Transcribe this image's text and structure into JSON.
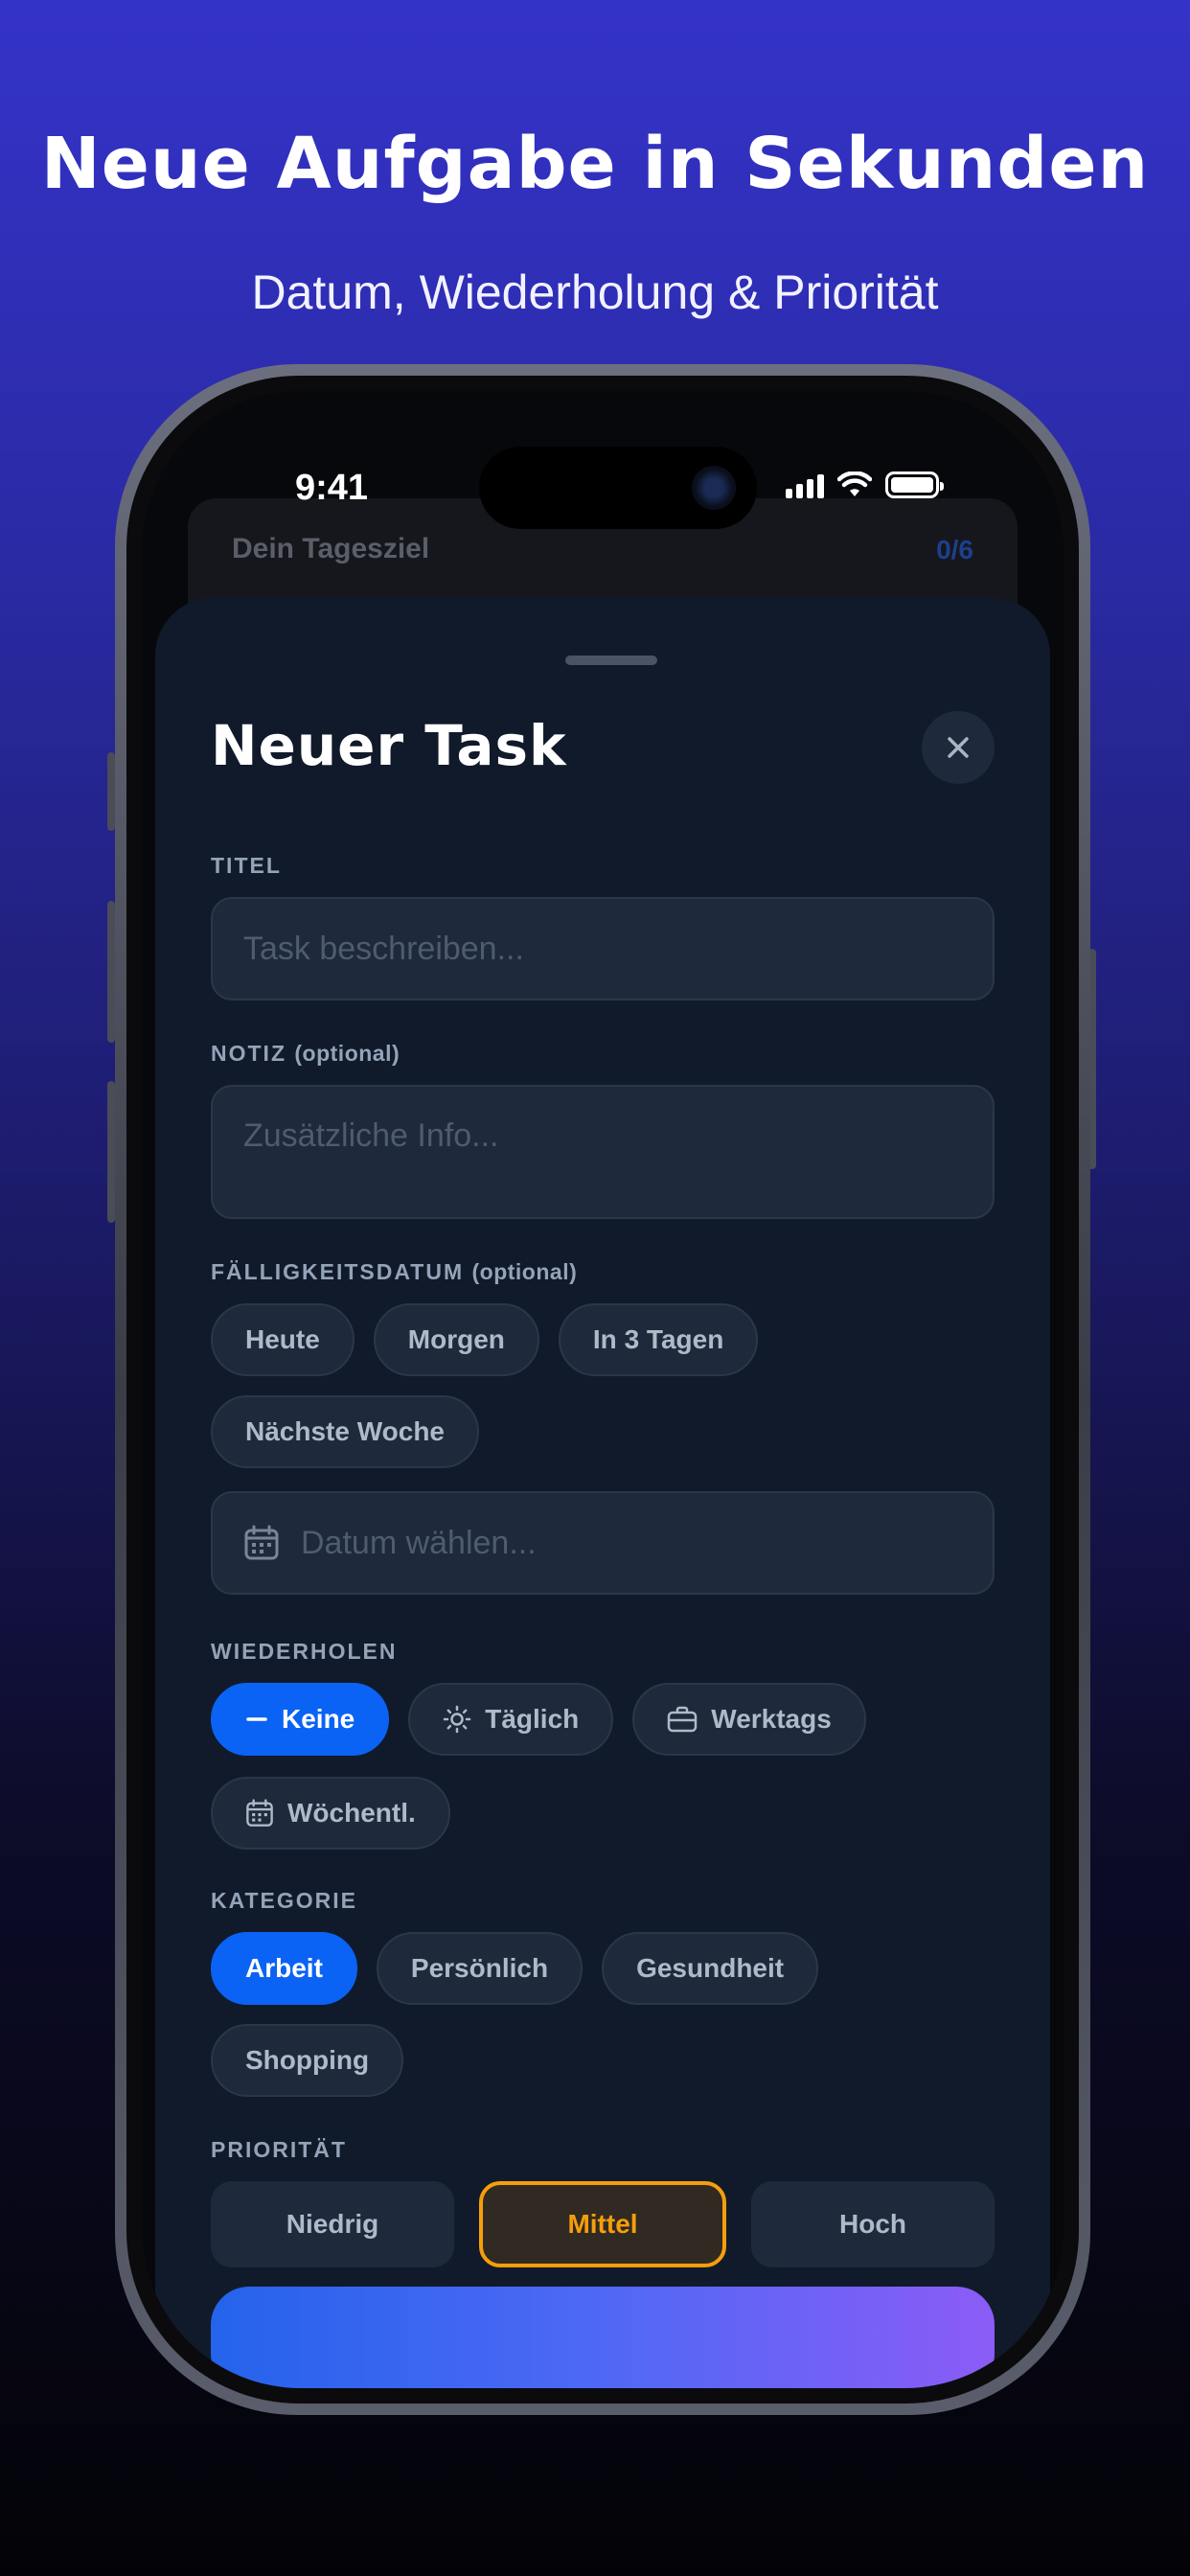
{
  "promo": {
    "headline": "Neue Aufgabe in Sekunden",
    "subline": "Datum, Wiederholung & Priorität"
  },
  "status_bar": {
    "time": "9:41"
  },
  "background_card": {
    "title": "Dein Tagesziel",
    "count": "0/6"
  },
  "sheet": {
    "title": "Neuer Task",
    "close_icon": "close-icon",
    "title_field": {
      "label": "TITEL",
      "placeholder": "Task beschreiben..."
    },
    "note_field": {
      "label": "NOTIZ",
      "label_suffix": "(optional)",
      "placeholder": "Zusätzliche Info..."
    },
    "due_date": {
      "label": "FÄLLIGKEITSDATUM",
      "label_suffix": "(optional)",
      "chips": [
        "Heute",
        "Morgen",
        "In 3 Tagen",
        "Nächste Woche"
      ],
      "picker_placeholder": "Datum wählen...",
      "picker_icon": "calendar-icon"
    },
    "repeat": {
      "label": "WIEDERHOLEN",
      "options": [
        {
          "label": "Keine",
          "icon": "minus-icon",
          "selected": true
        },
        {
          "label": "Täglich",
          "icon": "sun-icon",
          "selected": false
        },
        {
          "label": "Werktags",
          "icon": "briefcase-icon",
          "selected": false
        },
        {
          "label": "Wöchentl.",
          "icon": "calendar-icon",
          "selected": false
        }
      ]
    },
    "category": {
      "label": "KATEGORIE",
      "options": [
        {
          "label": "Arbeit",
          "selected": true
        },
        {
          "label": "Persönlich",
          "selected": false
        },
        {
          "label": "Gesundheit",
          "selected": false
        },
        {
          "label": "Shopping",
          "selected": false
        }
      ]
    },
    "priority": {
      "label": "PRIORITÄT",
      "options": [
        {
          "label": "Niedrig",
          "selected": false
        },
        {
          "label": "Mittel",
          "selected": true
        },
        {
          "label": "Hoch",
          "selected": false
        }
      ]
    }
  },
  "colors": {
    "accent_blue": "#0b63f5",
    "priority_selected": "#f59e0b",
    "sheet_bg": "#111a2a",
    "field_bg": "#1e293b"
  }
}
